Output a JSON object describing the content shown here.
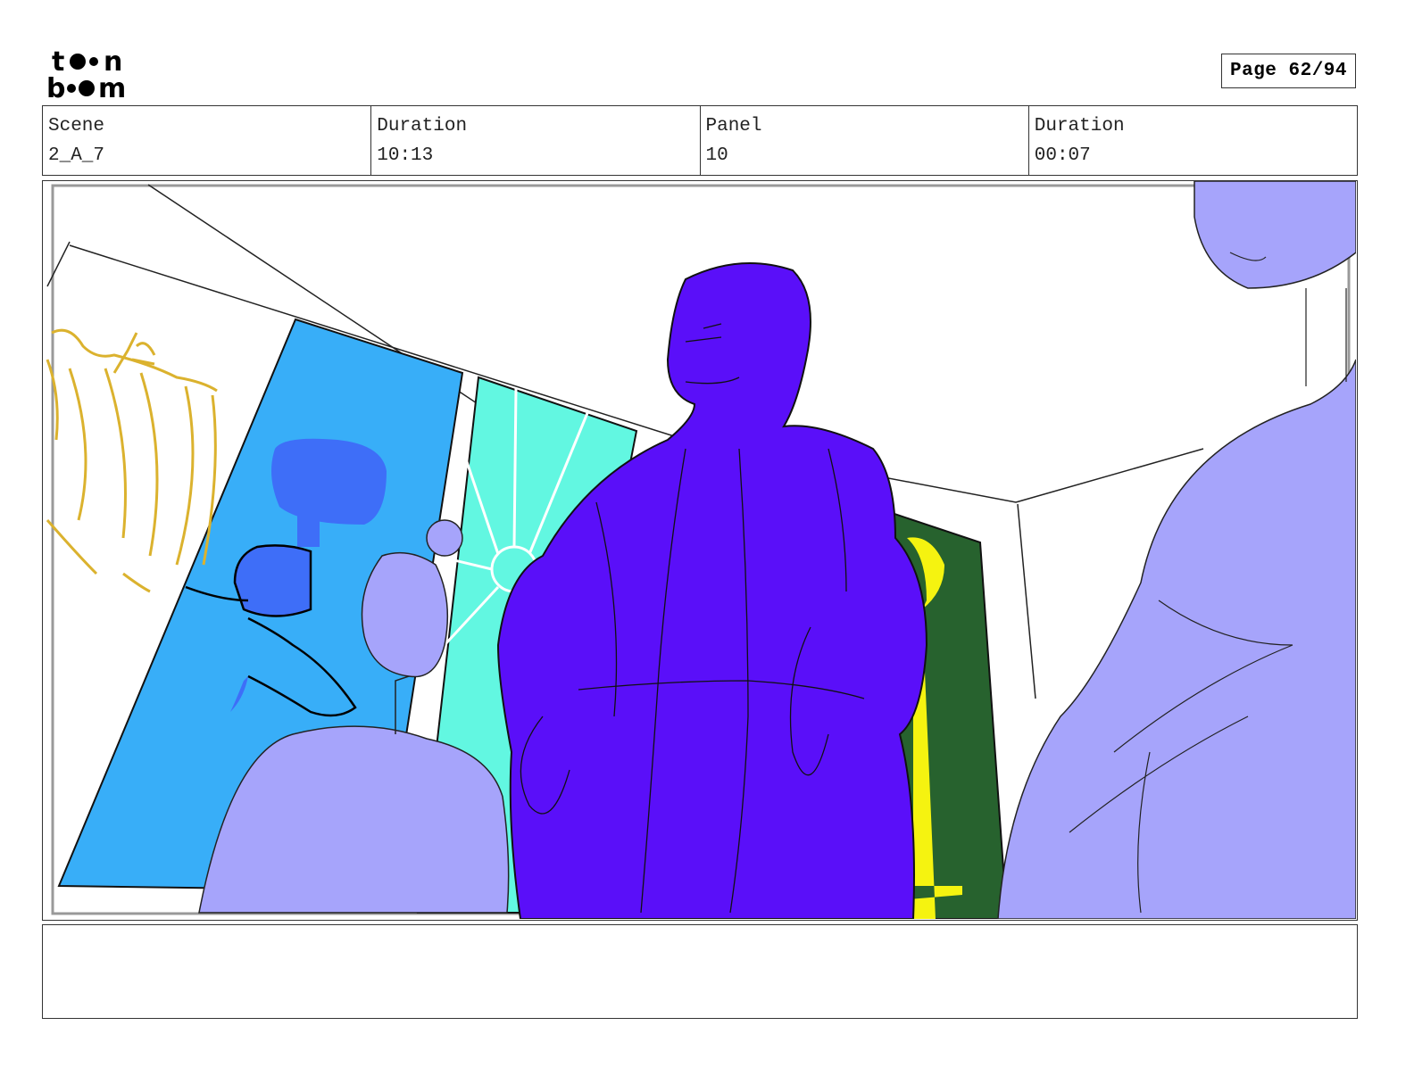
{
  "brand": {
    "logo_text": "toon boom",
    "icon": "toon-boom-logo"
  },
  "page_label": "Page 62/94",
  "header": {
    "scene_label": "Scene",
    "scene_value": "2_A_7",
    "duration_label": "Duration",
    "duration_value": "10:13",
    "panel_label": "Panel",
    "panel_value": "10",
    "panel_duration_label": "Duration",
    "panel_duration_value": "00:07"
  },
  "panel_image": {
    "description_icon": "storyboard-sketch-image",
    "colors": {
      "blue_banner": "#38aef8",
      "teal_banner": "#62f7e1",
      "green_banner": "#27622e",
      "main_character": "#5a0ff9",
      "side_figures": "#a6a4fb",
      "gold_sketch": "#dbb22e",
      "staff_yellow": "#f5f310",
      "hammer_blue": "#3e6ef8"
    }
  },
  "notes": {
    "text": ""
  }
}
